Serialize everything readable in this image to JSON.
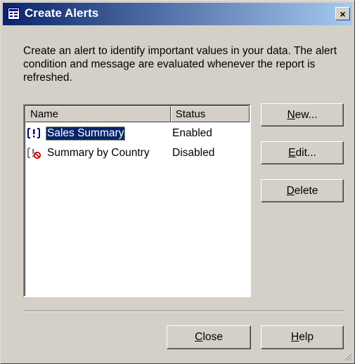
{
  "window": {
    "title": "Create Alerts",
    "close_glyph": "×",
    "title_icon": "alerts-window-icon"
  },
  "description": "Create an alert to identify important values in your data. The alert condition and message are evaluated whenever the report is refreshed.",
  "alerts_list": {
    "columns": [
      "Name",
      "Status"
    ],
    "rows": [
      {
        "name": "Sales Summary",
        "status": "Enabled",
        "icon": "alert-enabled-icon",
        "selected": true
      },
      {
        "name": "Summary by Country",
        "status": "Disabled",
        "icon": "alert-disabled-icon",
        "selected": false
      }
    ]
  },
  "buttons": {
    "new": {
      "mnemonic": "N",
      "rest": "ew..."
    },
    "edit": {
      "mnemonic": "E",
      "rest": "dit..."
    },
    "delete": {
      "mnemonic": "D",
      "rest": "elete"
    },
    "close": {
      "mnemonic": "C",
      "rest": "lose"
    },
    "help": {
      "mnemonic": "H",
      "rest": "elp"
    }
  },
  "colors": {
    "titlebar_start": "#0a246a",
    "titlebar_end": "#a6caf0",
    "dialog_face": "#d4d0c8",
    "selection": "#0a246a"
  }
}
